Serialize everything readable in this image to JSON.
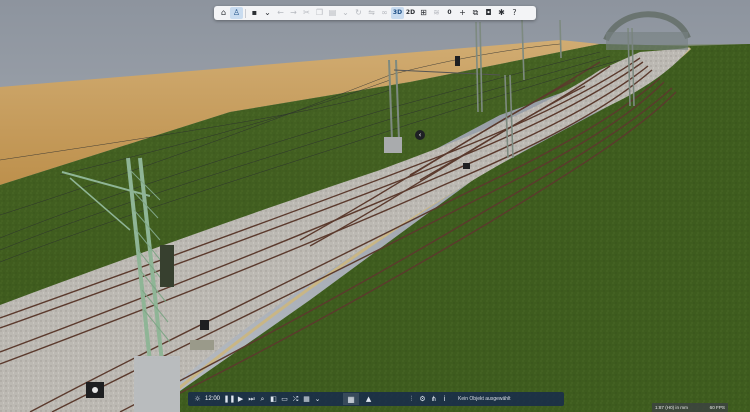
{
  "toolbar": {
    "buttons": [
      {
        "name": "home-icon",
        "glyph": "⌂"
      },
      {
        "name": "person-icon",
        "glyph": "♙",
        "active": true
      },
      {
        "name": "save-icon",
        "glyph": "▪"
      },
      {
        "name": "chevron-down-icon",
        "glyph": "⌄"
      },
      {
        "name": "undo-icon",
        "glyph": "←",
        "dim": true
      },
      {
        "name": "redo-icon",
        "glyph": "→",
        "dim": true
      },
      {
        "name": "cut-icon",
        "glyph": "✂",
        "dim": true
      },
      {
        "name": "copy-icon",
        "glyph": "❐",
        "dim": true
      },
      {
        "name": "paste-icon",
        "glyph": "▤",
        "dim": true
      },
      {
        "name": "chevron-down-icon",
        "glyph": "⌄",
        "dim": true
      },
      {
        "name": "rotate-icon",
        "glyph": "↻",
        "dim": true
      },
      {
        "name": "mirror-icon",
        "glyph": "⇋",
        "dim": true
      },
      {
        "name": "link-icon",
        "glyph": "∞",
        "dim": true
      }
    ],
    "view_3d": "3D",
    "view_2d": "2D",
    "buttons_right": [
      {
        "name": "grid-icon",
        "glyph": "⊞"
      },
      {
        "name": "layers-icon",
        "glyph": "≋",
        "dim": true
      },
      {
        "name": "count-badge",
        "glyph": "0"
      },
      {
        "name": "add-icon",
        "glyph": "+"
      },
      {
        "name": "windows-icon",
        "glyph": "⧉"
      },
      {
        "name": "camera-icon",
        "glyph": "◘"
      },
      {
        "name": "puzzle-icon",
        "glyph": "✱"
      },
      {
        "name": "help-icon",
        "glyph": "?"
      }
    ]
  },
  "bottombar": {
    "sun_icon": "☼",
    "time": "12:00",
    "pause_icon": "❚❚",
    "play_icon": "▶",
    "fast_forward_icon": "⏭",
    "buttons": [
      {
        "name": "search-icon",
        "glyph": "⌕"
      },
      {
        "name": "locomotive-icon",
        "glyph": "◧"
      },
      {
        "name": "train-icon",
        "glyph": "▭"
      },
      {
        "name": "shuffle-icon",
        "glyph": "⤮"
      },
      {
        "name": "catalog-icon",
        "glyph": "▦"
      },
      {
        "name": "chevron-down-icon",
        "glyph": "⌄"
      }
    ],
    "layout_icon": "▦",
    "terrain_icon": "▲",
    "tools": [
      {
        "name": "sliders-icon",
        "glyph": "⫶"
      },
      {
        "name": "gear-icon",
        "glyph": "⚙"
      },
      {
        "name": "network-icon",
        "glyph": "⋔"
      },
      {
        "name": "info-icon",
        "glyph": "i"
      }
    ],
    "status": "Kein Objekt ausgewählt"
  },
  "statusbox": {
    "left": "1:87 (H0) in mm",
    "right": "60 FPS"
  },
  "viewport": {
    "back_icon": "‹"
  },
  "colors": {
    "sky": "#9aa1ab",
    "field": "#c69b5a",
    "grass": "#3f5a1f",
    "ballast": "#b9b6b0",
    "rail": "#5a3a2e",
    "mast": "#8fb596"
  }
}
